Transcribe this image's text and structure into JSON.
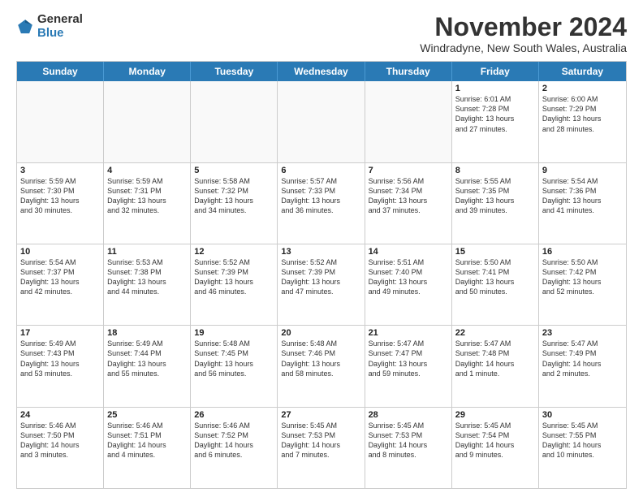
{
  "logo": {
    "general": "General",
    "blue": "Blue"
  },
  "header": {
    "month": "November 2024",
    "location": "Windradyne, New South Wales, Australia"
  },
  "days": [
    "Sunday",
    "Monday",
    "Tuesday",
    "Wednesday",
    "Thursday",
    "Friday",
    "Saturday"
  ],
  "weeks": [
    [
      {
        "day": "",
        "lines": [],
        "empty": true
      },
      {
        "day": "",
        "lines": [],
        "empty": true
      },
      {
        "day": "",
        "lines": [],
        "empty": true
      },
      {
        "day": "",
        "lines": [],
        "empty": true
      },
      {
        "day": "",
        "lines": [],
        "empty": true
      },
      {
        "day": "1",
        "lines": [
          "Sunrise: 6:01 AM",
          "Sunset: 7:28 PM",
          "Daylight: 13 hours",
          "and 27 minutes."
        ],
        "empty": false
      },
      {
        "day": "2",
        "lines": [
          "Sunrise: 6:00 AM",
          "Sunset: 7:29 PM",
          "Daylight: 13 hours",
          "and 28 minutes."
        ],
        "empty": false
      }
    ],
    [
      {
        "day": "3",
        "lines": [
          "Sunrise: 5:59 AM",
          "Sunset: 7:30 PM",
          "Daylight: 13 hours",
          "and 30 minutes."
        ],
        "empty": false
      },
      {
        "day": "4",
        "lines": [
          "Sunrise: 5:59 AM",
          "Sunset: 7:31 PM",
          "Daylight: 13 hours",
          "and 32 minutes."
        ],
        "empty": false
      },
      {
        "day": "5",
        "lines": [
          "Sunrise: 5:58 AM",
          "Sunset: 7:32 PM",
          "Daylight: 13 hours",
          "and 34 minutes."
        ],
        "empty": false
      },
      {
        "day": "6",
        "lines": [
          "Sunrise: 5:57 AM",
          "Sunset: 7:33 PM",
          "Daylight: 13 hours",
          "and 36 minutes."
        ],
        "empty": false
      },
      {
        "day": "7",
        "lines": [
          "Sunrise: 5:56 AM",
          "Sunset: 7:34 PM",
          "Daylight: 13 hours",
          "and 37 minutes."
        ],
        "empty": false
      },
      {
        "day": "8",
        "lines": [
          "Sunrise: 5:55 AM",
          "Sunset: 7:35 PM",
          "Daylight: 13 hours",
          "and 39 minutes."
        ],
        "empty": false
      },
      {
        "day": "9",
        "lines": [
          "Sunrise: 5:54 AM",
          "Sunset: 7:36 PM",
          "Daylight: 13 hours",
          "and 41 minutes."
        ],
        "empty": false
      }
    ],
    [
      {
        "day": "10",
        "lines": [
          "Sunrise: 5:54 AM",
          "Sunset: 7:37 PM",
          "Daylight: 13 hours",
          "and 42 minutes."
        ],
        "empty": false
      },
      {
        "day": "11",
        "lines": [
          "Sunrise: 5:53 AM",
          "Sunset: 7:38 PM",
          "Daylight: 13 hours",
          "and 44 minutes."
        ],
        "empty": false
      },
      {
        "day": "12",
        "lines": [
          "Sunrise: 5:52 AM",
          "Sunset: 7:39 PM",
          "Daylight: 13 hours",
          "and 46 minutes."
        ],
        "empty": false
      },
      {
        "day": "13",
        "lines": [
          "Sunrise: 5:52 AM",
          "Sunset: 7:39 PM",
          "Daylight: 13 hours",
          "and 47 minutes."
        ],
        "empty": false
      },
      {
        "day": "14",
        "lines": [
          "Sunrise: 5:51 AM",
          "Sunset: 7:40 PM",
          "Daylight: 13 hours",
          "and 49 minutes."
        ],
        "empty": false
      },
      {
        "day": "15",
        "lines": [
          "Sunrise: 5:50 AM",
          "Sunset: 7:41 PM",
          "Daylight: 13 hours",
          "and 50 minutes."
        ],
        "empty": false
      },
      {
        "day": "16",
        "lines": [
          "Sunrise: 5:50 AM",
          "Sunset: 7:42 PM",
          "Daylight: 13 hours",
          "and 52 minutes."
        ],
        "empty": false
      }
    ],
    [
      {
        "day": "17",
        "lines": [
          "Sunrise: 5:49 AM",
          "Sunset: 7:43 PM",
          "Daylight: 13 hours",
          "and 53 minutes."
        ],
        "empty": false
      },
      {
        "day": "18",
        "lines": [
          "Sunrise: 5:49 AM",
          "Sunset: 7:44 PM",
          "Daylight: 13 hours",
          "and 55 minutes."
        ],
        "empty": false
      },
      {
        "day": "19",
        "lines": [
          "Sunrise: 5:48 AM",
          "Sunset: 7:45 PM",
          "Daylight: 13 hours",
          "and 56 minutes."
        ],
        "empty": false
      },
      {
        "day": "20",
        "lines": [
          "Sunrise: 5:48 AM",
          "Sunset: 7:46 PM",
          "Daylight: 13 hours",
          "and 58 minutes."
        ],
        "empty": false
      },
      {
        "day": "21",
        "lines": [
          "Sunrise: 5:47 AM",
          "Sunset: 7:47 PM",
          "Daylight: 13 hours",
          "and 59 minutes."
        ],
        "empty": false
      },
      {
        "day": "22",
        "lines": [
          "Sunrise: 5:47 AM",
          "Sunset: 7:48 PM",
          "Daylight: 14 hours",
          "and 1 minute."
        ],
        "empty": false
      },
      {
        "day": "23",
        "lines": [
          "Sunrise: 5:47 AM",
          "Sunset: 7:49 PM",
          "Daylight: 14 hours",
          "and 2 minutes."
        ],
        "empty": false
      }
    ],
    [
      {
        "day": "24",
        "lines": [
          "Sunrise: 5:46 AM",
          "Sunset: 7:50 PM",
          "Daylight: 14 hours",
          "and 3 minutes."
        ],
        "empty": false
      },
      {
        "day": "25",
        "lines": [
          "Sunrise: 5:46 AM",
          "Sunset: 7:51 PM",
          "Daylight: 14 hours",
          "and 4 minutes."
        ],
        "empty": false
      },
      {
        "day": "26",
        "lines": [
          "Sunrise: 5:46 AM",
          "Sunset: 7:52 PM",
          "Daylight: 14 hours",
          "and 6 minutes."
        ],
        "empty": false
      },
      {
        "day": "27",
        "lines": [
          "Sunrise: 5:45 AM",
          "Sunset: 7:53 PM",
          "Daylight: 14 hours",
          "and 7 minutes."
        ],
        "empty": false
      },
      {
        "day": "28",
        "lines": [
          "Sunrise: 5:45 AM",
          "Sunset: 7:53 PM",
          "Daylight: 14 hours",
          "and 8 minutes."
        ],
        "empty": false
      },
      {
        "day": "29",
        "lines": [
          "Sunrise: 5:45 AM",
          "Sunset: 7:54 PM",
          "Daylight: 14 hours",
          "and 9 minutes."
        ],
        "empty": false
      },
      {
        "day": "30",
        "lines": [
          "Sunrise: 5:45 AM",
          "Sunset: 7:55 PM",
          "Daylight: 14 hours",
          "and 10 minutes."
        ],
        "empty": false
      }
    ]
  ]
}
